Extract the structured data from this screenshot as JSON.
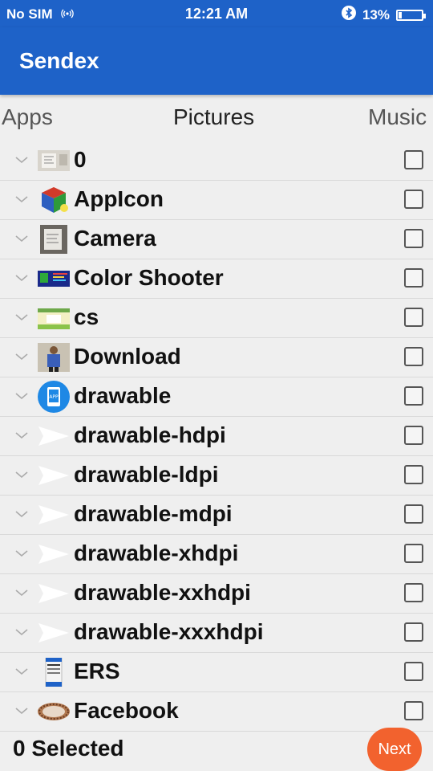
{
  "status": {
    "carrier": "No SIM",
    "time": "12:21 AM",
    "battery": "13%",
    "battery_level": 0.13
  },
  "app": {
    "title": "Sendex"
  },
  "tabs": [
    "Apps",
    "Pictures",
    "Music"
  ],
  "active_tab": "Pictures",
  "items": [
    {
      "label": "0",
      "icon": "photo-thumb-icon"
    },
    {
      "label": "AppIcon",
      "icon": "cube-icon"
    },
    {
      "label": "Camera",
      "icon": "camera-photo-thumb-icon"
    },
    {
      "label": "Color Shooter",
      "icon": "game-screenshot-icon"
    },
    {
      "label": "cs",
      "icon": "screenshot-thumb-icon"
    },
    {
      "label": "Download",
      "icon": "person-photo-icon"
    },
    {
      "label": "drawable",
      "icon": "app-logo-icon"
    },
    {
      "label": "drawable-hdpi",
      "icon": "paper-plane-icon"
    },
    {
      "label": "drawable-ldpi",
      "icon": "paper-plane-icon"
    },
    {
      "label": "drawable-mdpi",
      "icon": "paper-plane-icon"
    },
    {
      "label": "drawable-xhdpi",
      "icon": "paper-plane-icon"
    },
    {
      "label": "drawable-xxhdpi",
      "icon": "paper-plane-icon"
    },
    {
      "label": "drawable-xxxhdpi",
      "icon": "paper-plane-icon"
    },
    {
      "label": "ERS",
      "icon": "app-screenshot-icon"
    },
    {
      "label": "Facebook",
      "icon": "round-photo-icon"
    }
  ],
  "footer": {
    "selected": "0 Selected",
    "next": "Next"
  },
  "colors": {
    "primary": "#1e62c8",
    "accent": "#f2622e"
  }
}
